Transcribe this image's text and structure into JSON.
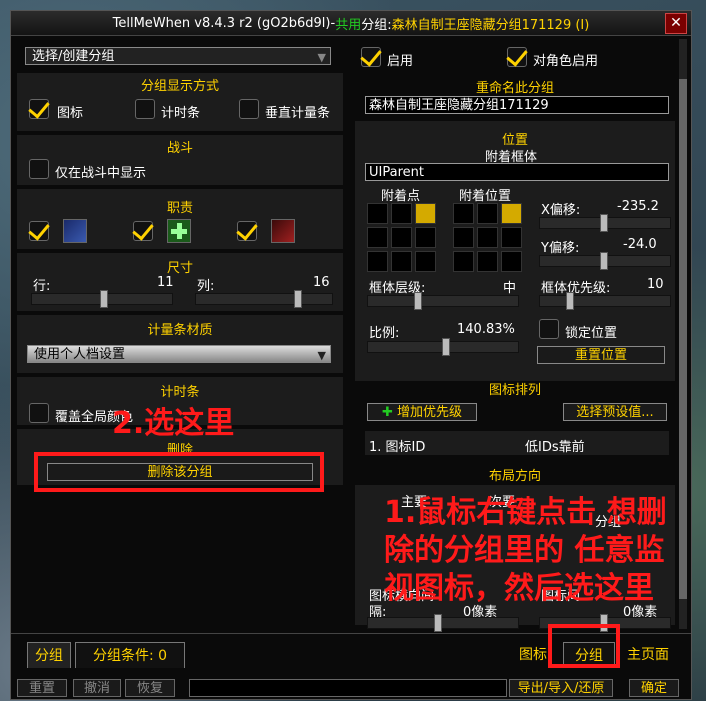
{
  "title": {
    "app": "TellMeWhen v8.4.3 r2 (gO2b6d9l)",
    "dash": " - ",
    "shared": "共用",
    "group_prefix": " 分组: ",
    "group_name": "森林自制王座隐藏分组171129 (I)"
  },
  "left": {
    "group_select": "选择/创建分组",
    "display_header": "分组显示方式",
    "display_opts": [
      "图标",
      "计时条",
      "垂直计量条"
    ],
    "combat_header": "战斗",
    "combat_only": "仅在战斗中显示",
    "class_header": "职责",
    "size_header": "尺寸",
    "rows_label": "行:",
    "rows_value": "11",
    "cols_label": "列:",
    "cols_value": "16",
    "bar_tex_header": "计量条材质",
    "bar_tex_value": "使用个人档设置",
    "timer_header": "计时条",
    "cover_color": "覆盖全局颜色",
    "delete_header": "删除",
    "delete_btn": "删除该分组"
  },
  "right": {
    "enabled": "启用",
    "role_enabled": "对角色启用",
    "rename_header": "重命名此分组",
    "rename_value": "森林自制王座隐藏分组171129",
    "pos_header": "位置",
    "anchor_frame_label": "附着框体",
    "anchor_frame_value": "UIParent",
    "anchor_point": "附着点",
    "anchor_pos": "附着位置",
    "x_label": "X偏移:",
    "x_value": "-235.2",
    "y_label": "Y偏移:",
    "y_value": "-24.0",
    "strata_label": "框体层级:",
    "strata_value": "中",
    "priority_label": "框体优先级:",
    "priority_value": "10",
    "scale_label": "比例:",
    "scale_value": "140.83%",
    "lock_pos": "锁定位置",
    "reset_pos": "重置位置",
    "icon_sort_header": "图标排列",
    "add_priority": "增加优先级",
    "choose_preset": "选择预设值...",
    "sort_row_left": "1. 图标ID",
    "sort_row_right": "低IDs靠前",
    "layout_header": "布局方向",
    "primary": "主要",
    "secondary": "次要",
    "icon_spacing_left": "图标横向间",
    "spacing_left_sub": "隔:",
    "spacing_left_val": "0像素",
    "icon_spacing_right": "图标间",
    "spacing_right_val": "0像素",
    "group_word": "分组"
  },
  "tabs": {
    "group": "分组",
    "group_cond": "分组条件: 0",
    "icon": "图标",
    "group2": "分组",
    "main": "主页面"
  },
  "bottom": {
    "reset": "重置",
    "undo": "撤消",
    "redo": "恢复",
    "export": "导出/导入/还原",
    "ok": "确定"
  },
  "annotations": {
    "a2": "2.选这里",
    "a1_line1": "1.鼠标右键点击 想删",
    "a1_line2": "除的分组里的 任意监",
    "a1_line3": "视图标，然后选这里"
  },
  "colors": {
    "accent": "#ffd200",
    "annotation": "#ff1a1a",
    "shared_green": "#22cc22"
  }
}
